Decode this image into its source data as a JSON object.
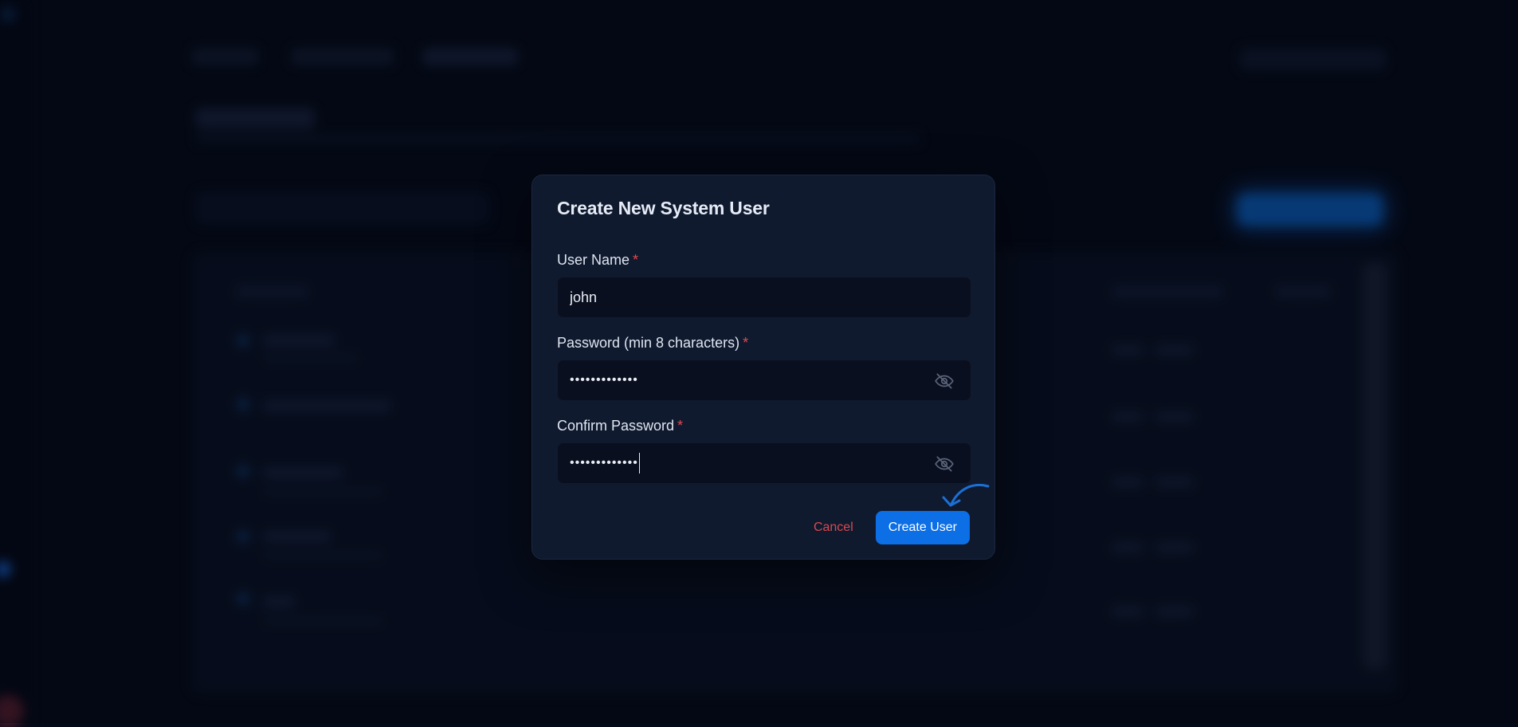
{
  "dialog": {
    "title": "Create New System User",
    "fields": [
      {
        "label": "User Name",
        "required": "*",
        "value": "john",
        "type": "text"
      },
      {
        "label": "Password (min 8 characters)",
        "required": "*",
        "value": "•••••••••••••",
        "type": "password"
      },
      {
        "label": "Confirm Password",
        "required": "*",
        "value": "•••••••••••••",
        "type": "password"
      }
    ],
    "cancel_label": "Cancel",
    "submit_label": "Create User"
  },
  "icons": {
    "toggle_visibility": "eye-off-icon",
    "hint": "curved-arrow-icon"
  },
  "colors": {
    "accent": "#0d6fe6",
    "danger": "#e5484d",
    "modal_bg": "#0f1a2f",
    "input_bg": "#0a0f1f"
  }
}
